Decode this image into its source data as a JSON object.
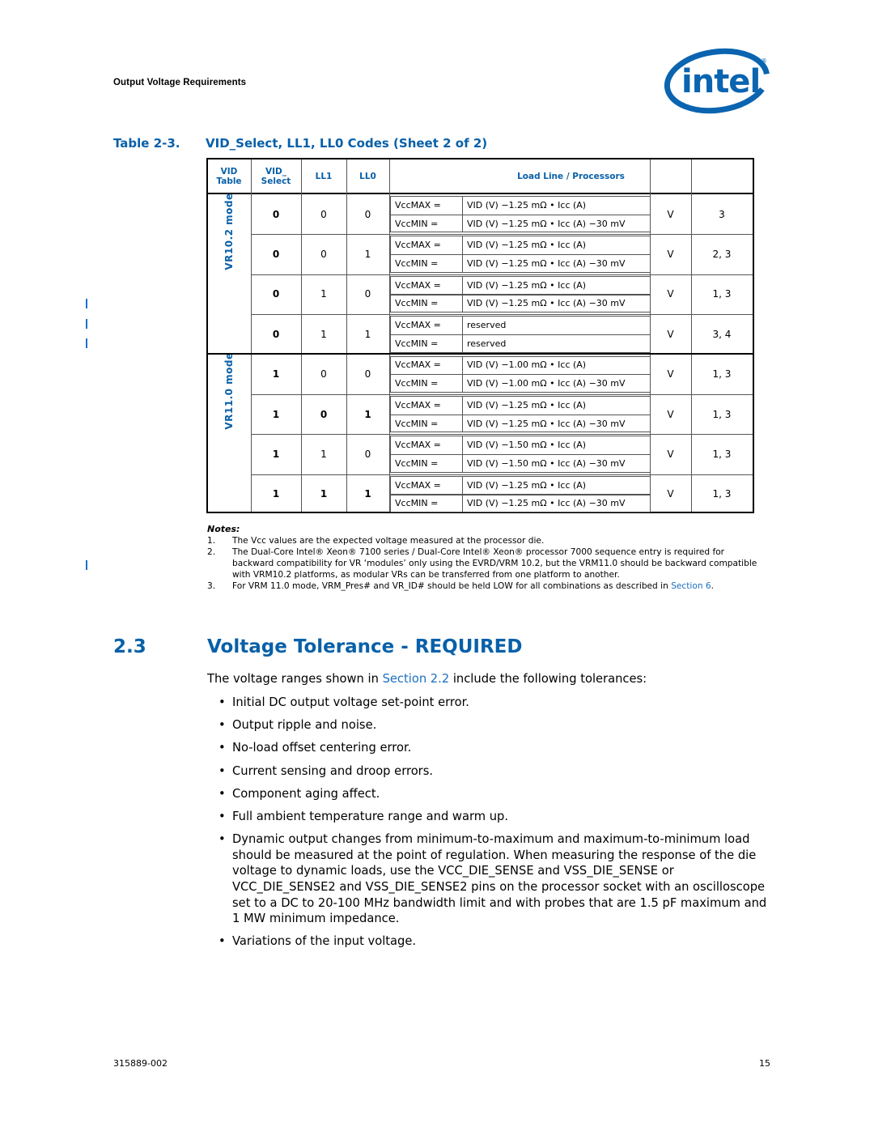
{
  "header": {
    "running_head": "Output Voltage Requirements",
    "logo": "intel-logo"
  },
  "table": {
    "caption_number": "Table 2-3.",
    "caption_title": "VID_Select, LL1, LL0 Codes (Sheet 2 of 2)",
    "columns": {
      "vid_table": [
        "VID",
        "Table"
      ],
      "vid_select": [
        "VID_",
        "Select"
      ],
      "ll1": "LL1",
      "ll0": "LL0",
      "load_line": "Load Line / Processors"
    },
    "groups": [
      {
        "label": "VR10.2 mode",
        "rows": [
          {
            "vid_select": "0",
            "ll1": "0",
            "ll0": "0",
            "max_label": "VccMAX =",
            "max": "VID (V) −1.25 mΩ • Icc (A)",
            "min_label": "VccMIN =",
            "min": "VID (V) −1.25 mΩ • Icc (A) −30 mV",
            "unit": "V",
            "notes": "3",
            "bold": [
              true,
              false,
              false
            ]
          },
          {
            "vid_select": "0",
            "ll1": "0",
            "ll0": "1",
            "max_label": "VccMAX =",
            "max": "VID (V) −1.25 mΩ • Icc (A)",
            "min_label": "VccMIN =",
            "min": "VID (V) −1.25 mΩ • Icc (A) −30 mV",
            "unit": "V",
            "notes": "2, 3",
            "bold": [
              true,
              false,
              false
            ]
          },
          {
            "vid_select": "0",
            "ll1": "1",
            "ll0": "0",
            "max_label": "VccMAX =",
            "max": "VID (V) −1.25 mΩ • Icc (A)",
            "min_label": "VccMIN =",
            "min": "VID (V) −1.25 mΩ • Icc (A) −30 mV",
            "unit": "V",
            "notes": "1, 3",
            "bold": [
              true,
              false,
              false
            ]
          },
          {
            "vid_select": "0",
            "ll1": "1",
            "ll0": "1",
            "max_label": "VccMAX =",
            "max": "reserved",
            "min_label": "VccMIN =",
            "min": "reserved",
            "unit": "V",
            "notes": "3, 4",
            "bold": [
              true,
              false,
              false
            ]
          }
        ]
      },
      {
        "label": "VR11.0 mode",
        "rows": [
          {
            "vid_select": "1",
            "ll1": "0",
            "ll0": "0",
            "max_label": "VccMAX =",
            "max": "VID (V) −1.00 mΩ • Icc (A)",
            "min_label": "VccMIN =",
            "min": "VID (V) −1.00 mΩ • Icc (A) −30 mV",
            "unit": "V",
            "notes": "1, 3",
            "bold": [
              true,
              false,
              false
            ]
          },
          {
            "vid_select": "1",
            "ll1": "0",
            "ll0": "1",
            "max_label": "VccMAX =",
            "max": "VID (V) −1.25 mΩ • Icc (A)",
            "min_label": "VccMIN =",
            "min": "VID (V) −1.25 mΩ • Icc (A) −30 mV",
            "unit": "V",
            "notes": "1, 3",
            "bold": [
              true,
              true,
              true
            ]
          },
          {
            "vid_select": "1",
            "ll1": "1",
            "ll0": "0",
            "max_label": "VccMAX =",
            "max": "VID (V) −1.50 mΩ • Icc (A)",
            "min_label": "VccMIN =",
            "min": "VID (V) −1.50 mΩ • Icc (A) −30 mV",
            "unit": "V",
            "notes": "1, 3",
            "bold": [
              true,
              false,
              false
            ]
          },
          {
            "vid_select": "1",
            "ll1": "1",
            "ll0": "1",
            "max_label": "VccMAX =",
            "max": "VID (V) −1.25 mΩ • Icc (A)",
            "min_label": "VccMIN =",
            "min": "VID (V) −1.25 mΩ • Icc (A) −30 mV",
            "unit": "V",
            "notes": "1, 3",
            "bold": [
              true,
              true,
              true
            ]
          }
        ]
      }
    ]
  },
  "notes": {
    "title": "Notes:",
    "items": [
      {
        "n": "1.",
        "text": "The Vcc values are the expected voltage measured at the processor die."
      },
      {
        "n": "2.",
        "text": "The Dual-Core Intel® Xeon® 7100 series / Dual-Core Intel® Xeon® processor 7000 sequence entry is required for backward compatibility for VR ‘modules’ only using the EVRD/VRM 10.2, but the VRM11.0 should be backward compatible with VRM10.2 platforms, as modular VRs can be transferred from one platform to another."
      },
      {
        "n": "3.",
        "text": "For VRM 11.0 mode, VRM_Pres# and VR_ID# should be held LOW for all combinations as described in ",
        "link": "Section 6",
        "after": "."
      }
    ]
  },
  "section": {
    "number": "2.3",
    "title": "Voltage Tolerance - REQUIRED",
    "intro_before": "The voltage ranges shown in ",
    "intro_link": "Section 2.2",
    "intro_after": " include the following tolerances:",
    "bullets": [
      "Initial DC output voltage set-point error.",
      "Output ripple and noise.",
      "No-load offset centering error.",
      "Current sensing and droop errors.",
      "Component aging affect.",
      "Full ambient temperature range and warm up.",
      "Dynamic output changes from minimum-to-maximum and maximum-to-minimum load should be measured at the point of regulation. When measuring the response of the die voltage to dynamic loads, use the VCC_DIE_SENSE and VSS_DIE_SENSE or VCC_DIE_SENSE2 and VSS_DIE_SENSE2 pins on the processor socket with an oscilloscope set to a DC to 20-100 MHz bandwidth limit and with probes that are 1.5 pF maximum and 1 MW minimum impedance.",
      "Variations of the input voltage."
    ]
  },
  "footer": {
    "doc_number": "315889-002",
    "page_number": "15"
  },
  "colors": {
    "accent_blue": "#0860a8",
    "link_blue": "#1a6fc0",
    "change_bar": "#1a72cf"
  }
}
